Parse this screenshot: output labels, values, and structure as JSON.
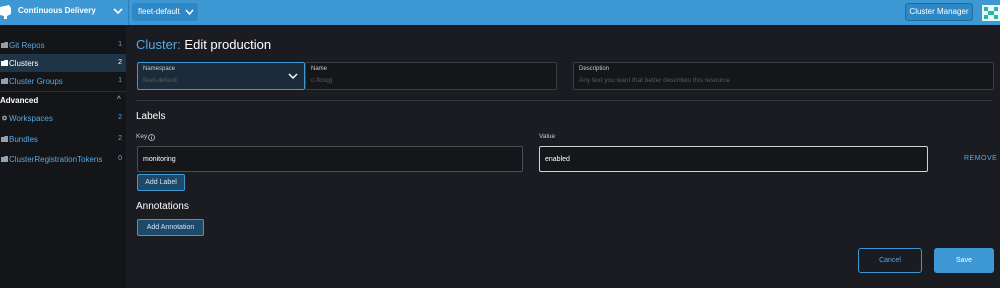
{
  "header": {
    "product_name": "Continuous Delivery",
    "workspace": "fleet-default",
    "cluster_manager_label": "Cluster Manager"
  },
  "sidebar": {
    "items": [
      {
        "label": "Git Repos",
        "count": "1",
        "icon": "folder-icon",
        "active": false
      },
      {
        "label": "Clusters",
        "count": "2",
        "icon": "folder-icon",
        "active": true
      },
      {
        "label": "Cluster Groups",
        "count": "1",
        "icon": "folder-icon",
        "active": false
      }
    ],
    "group_label": "Advanced",
    "group_chevron": "^",
    "advanced_items": [
      {
        "label": "Workspaces",
        "count": "2",
        "icon": "gear-icon"
      },
      {
        "label": "Bundles",
        "count": "2",
        "icon": "folder-icon"
      },
      {
        "label": "ClusterRegistrationTokens",
        "count": "0",
        "icon": "folder-icon"
      }
    ]
  },
  "main": {
    "title_kind": "Cluster:",
    "title_action": "Edit production",
    "namespace": {
      "label": "Namespace",
      "value": "fleet-default"
    },
    "name": {
      "label": "Name",
      "value": "c-fknqg"
    },
    "description": {
      "label": "Description",
      "placeholder": "Any text you want that better describes this resource"
    },
    "labels_title": "Labels",
    "key_label": "Key",
    "value_label": "Value",
    "label_key": "monitoring",
    "label_value": "enabled",
    "remove_label": "REMOVE",
    "add_label": "Add Label",
    "annotations_title": "Annotations",
    "add_annotation": "Add Annotation",
    "cancel_label": "Cancel",
    "save_label": "Save"
  },
  "colors": {
    "accent": "#3d98d3",
    "link": "#5aa7e0",
    "background": "#1b1c21",
    "sidebar_bg": "#141518"
  }
}
